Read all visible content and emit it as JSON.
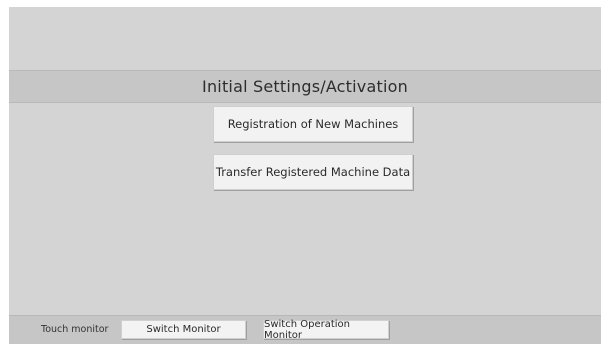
{
  "screen": {
    "title": "Initial Settings/Activation",
    "buttons": {
      "registration": "Registration of New Machines",
      "transfer": "Transfer Registered Machine Data"
    }
  },
  "footer": {
    "touch_label": "Touch monitor",
    "switch_monitor": "Switch Monitor",
    "switch_operation_monitor": "Switch Operation Monitor"
  }
}
